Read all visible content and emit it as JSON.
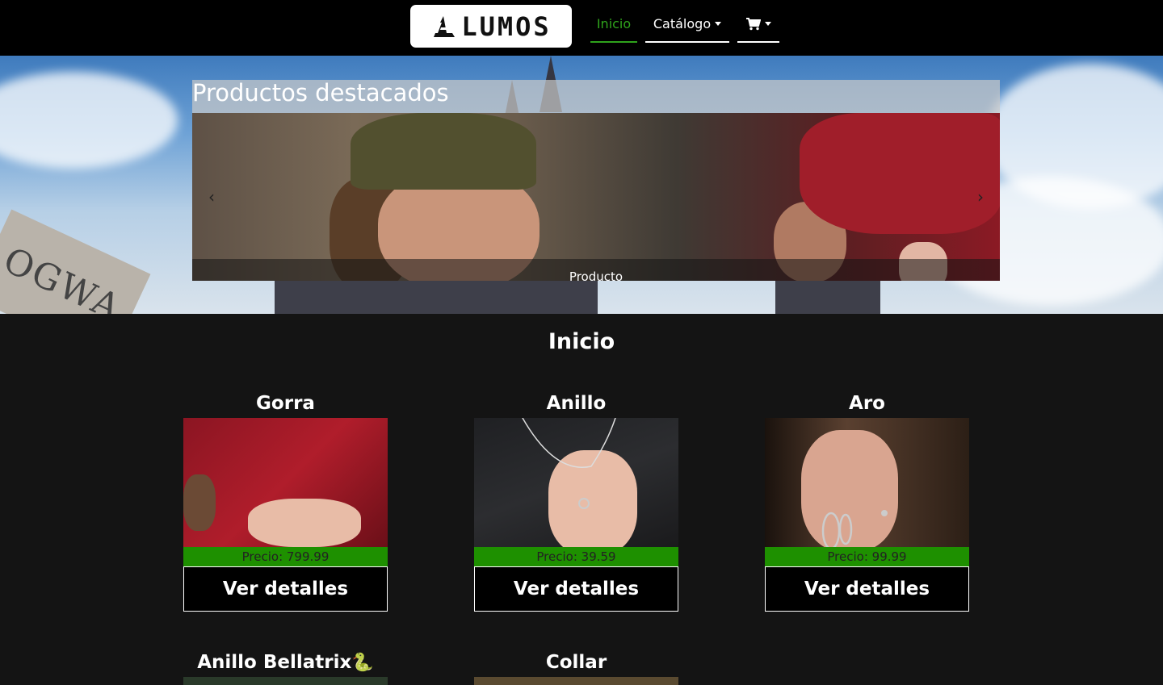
{
  "nav": {
    "logo_text": "LUMOS",
    "items": [
      {
        "label": "Inicio",
        "active": true
      },
      {
        "label": "Catálogo",
        "dropdown": true
      },
      {
        "label": "",
        "icon": "cart-icon",
        "dropdown": true
      }
    ]
  },
  "hero": {
    "title": "Productos destacados",
    "caption": "Producto",
    "background_text": "OGWA"
  },
  "main": {
    "title": "Inicio",
    "products": [
      {
        "name": "Gorra",
        "price_label": "Precio: 799.99",
        "button": "Ver detalles"
      },
      {
        "name": "Anillo",
        "price_label": "Precio: 39.59",
        "button": "Ver detalles"
      },
      {
        "name": "Aro",
        "price_label": "Precio: 99.99",
        "button": "Ver detalles"
      },
      {
        "name": "Anillo Bellatrix",
        "icon": "snake-icon"
      },
      {
        "name": "Collar"
      }
    ]
  },
  "colors": {
    "navbar_bg": "#000000",
    "accent_green": "#2fa31c",
    "price_bg": "#1e9000",
    "page_bg": "#141414"
  }
}
